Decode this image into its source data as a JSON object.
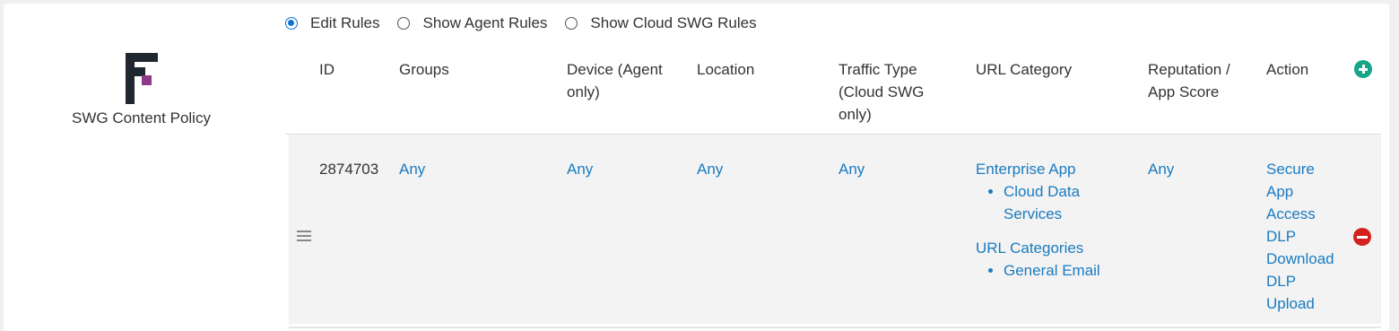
{
  "policy": {
    "label": "SWG Content Policy"
  },
  "view_options": [
    {
      "label": "Edit Rules",
      "selected": true
    },
    {
      "label": "Show Agent Rules",
      "selected": false
    },
    {
      "label": "Show Cloud SWG Rules",
      "selected": false
    }
  ],
  "table": {
    "headers": {
      "id": "ID",
      "groups": "Groups",
      "device": "Device (Agent only)",
      "location": "Location",
      "traffic_type": "Traffic Type (Cloud SWG only)",
      "url_category": "URL Category",
      "reputation": "Reputation / App Score",
      "action": "Action"
    },
    "rows": [
      {
        "id": "2874703",
        "groups": "Any",
        "device": "Any",
        "location": "Any",
        "traffic_type": "Any",
        "url_category": {
          "enterprise_app_title": "Enterprise App",
          "enterprise_app_items": [
            "Cloud Data Services"
          ],
          "url_categories_title": "URL Categories",
          "url_categories_items": [
            "General Email"
          ]
        },
        "reputation": "Any",
        "actions": [
          "Secure App Access",
          "DLP Download",
          "DLP Upload"
        ]
      }
    ]
  },
  "icons": {
    "add": "plus-circle-icon",
    "remove": "minus-circle-icon",
    "drag": "drag-handle-icon"
  },
  "colors": {
    "link": "#1a7bbf",
    "add": "#17a589",
    "remove": "#d62020",
    "row_bg": "#f3f3f3",
    "radio": "#0b74d6"
  }
}
